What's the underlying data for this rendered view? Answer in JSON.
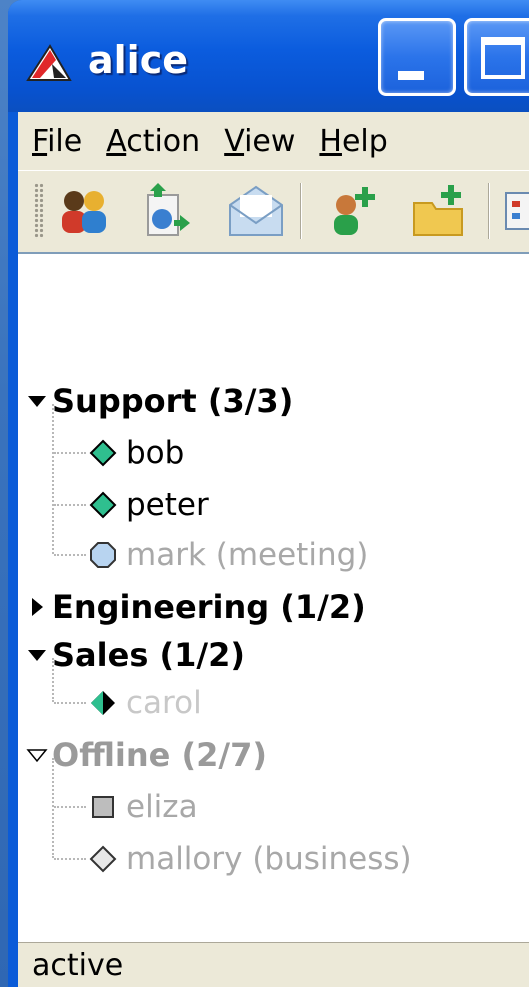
{
  "window": {
    "title": "alice"
  },
  "menu": [
    {
      "label": "File",
      "mnemonic": "F",
      "rest": "ile"
    },
    {
      "label": "Action",
      "mnemonic": "A",
      "rest": "ction"
    },
    {
      "label": "View",
      "mnemonic": "V",
      "rest": "iew"
    },
    {
      "label": "Help",
      "mnemonic": "H",
      "rest": "elp"
    }
  ],
  "toolbar": {
    "icons": [
      "contacts-icon",
      "send-file-icon",
      "message-icon",
      "add-contact-icon",
      "add-group-icon",
      "more-icon"
    ]
  },
  "groups": [
    {
      "label": "Support (3/3)",
      "expanded": true,
      "contacts": [
        {
          "name": "bob",
          "status": "online"
        },
        {
          "name": "peter",
          "status": "online"
        },
        {
          "name": "mark (meeting)",
          "status": "away"
        }
      ]
    },
    {
      "label": "Engineering (1/2)",
      "expanded": false,
      "contacts": []
    },
    {
      "label": "Sales (1/2)",
      "expanded": true,
      "contacts": [
        {
          "name": "carol",
          "status": "invisible"
        }
      ]
    },
    {
      "label": "Offline (2/7)",
      "expanded": true,
      "contacts": [
        {
          "name": "eliza",
          "status": "offline"
        },
        {
          "name": "mallory (business)",
          "status": "offline-business"
        }
      ]
    }
  ],
  "status": {
    "text": "active"
  },
  "colors": {
    "online": "#2fbf8f",
    "titlebar": "#0b5cde",
    "offline_text": "#a8a8a8"
  }
}
